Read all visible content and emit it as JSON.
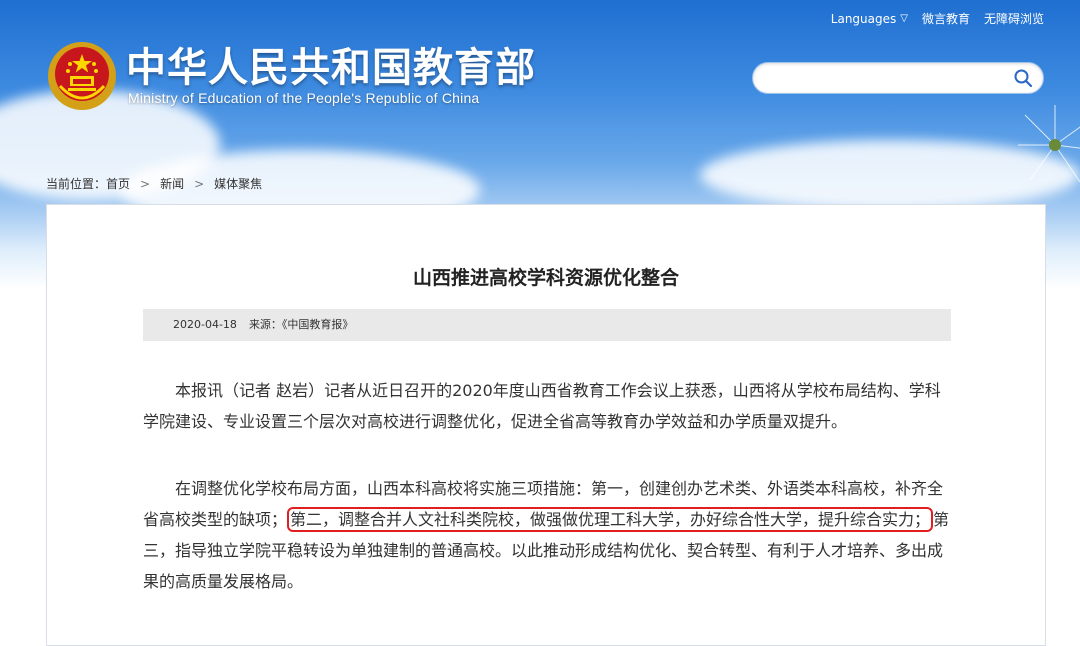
{
  "header": {
    "title_cn": "中华人民共和国教育部",
    "title_en": "Ministry of Education of the People's Republic of China",
    "links": [
      "Languages",
      "微言教育",
      "无障碍浏览"
    ],
    "search": {
      "value": "",
      "placeholder": ""
    },
    "emblem_icon": "national-emblem",
    "search_icon": "magnifier"
  },
  "breadcrumb": {
    "prefix": "当前位置：",
    "items": [
      "首页",
      "新闻",
      "媒体聚焦"
    ],
    "separator": ">"
  },
  "article": {
    "title": "山西推进高校学科资源优化整合",
    "date": "2020-04-18",
    "source": "来源：《中国教育报》",
    "p1": "本报讯（记者 赵岩）记者从近日召开的2020年度山西省教育工作会议上获悉，山西将从学校布局结构、学科学院建设、专业设置三个层次对高校进行调整优化，促进全省高等教育办学效益和办学质量双提升。",
    "p2_before": "在调整优化学校布局方面，山西本科高校将实施三项措施：第一，创建创办艺术类、外语类本科高校，补齐全省高校类型的缺项；",
    "p2_highlight": "第二，调整合并人文社科类院校，做强做优理工科大学，办好综合性大学，提升综合实力；",
    "p2_after": "第三，指导独立学院平稳转设为单独建制的普通高校。以此推动形成结构优化、契合转型、有利于人才培养、多出成果的高质量发展格局。"
  },
  "colors": {
    "highlight": "#e02020",
    "sky": "#1f6fd1",
    "meta_bg": "#e9e9e9"
  }
}
